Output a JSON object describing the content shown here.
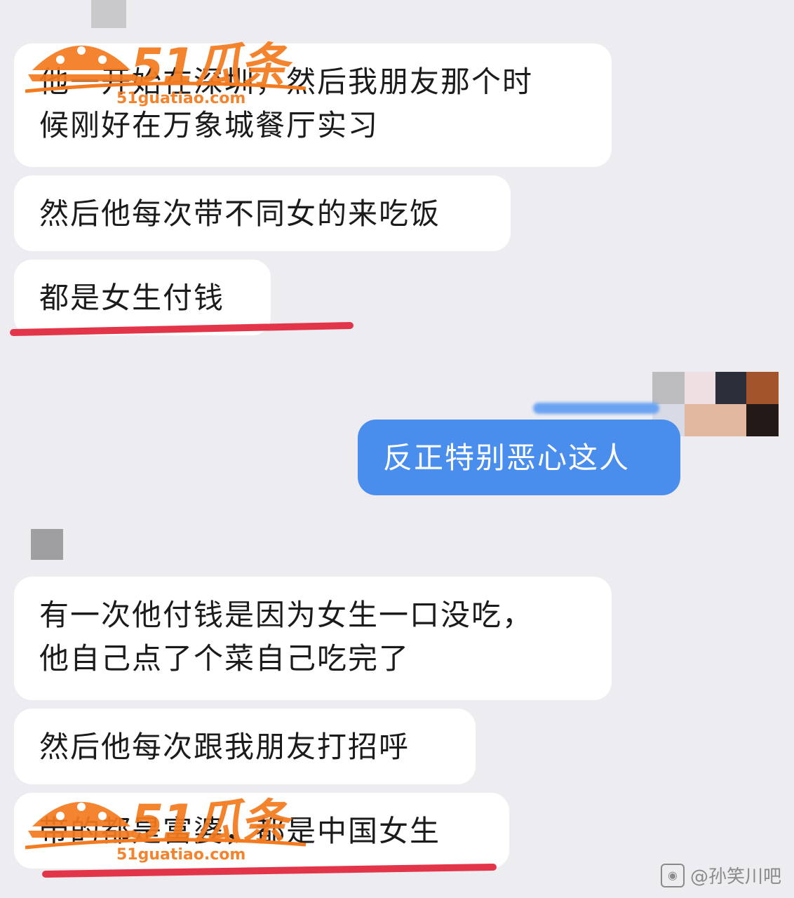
{
  "messages": [
    {
      "id": "m1",
      "direction": "received",
      "lines": [
        "他一开始在深圳，然后我朋友那个时",
        "候刚好在万象城餐厅实习"
      ]
    },
    {
      "id": "m2",
      "direction": "received",
      "lines": [
        "然后他每次带不同女的来吃饭"
      ]
    },
    {
      "id": "m3",
      "direction": "received",
      "lines": [
        "都是女生付钱"
      ],
      "underlined": true
    },
    {
      "id": "m4",
      "direction": "sent",
      "lines": [
        "反正特别恶心这人"
      ]
    },
    {
      "id": "m5",
      "direction": "received",
      "lines": [
        "有一次他付钱是因为女生一口没吃，",
        "他自己点了个菜自己吃完了"
      ]
    },
    {
      "id": "m6",
      "direction": "received",
      "lines": [
        "然后他每次跟我朋友打招呼"
      ]
    },
    {
      "id": "m7",
      "direction": "received",
      "lines": [
        "带的都是富婆，都是中国女生"
      ],
      "underlined": true
    }
  ],
  "watermark": {
    "brand": "51瓜条",
    "url": "51guatiao.com"
  },
  "credit": {
    "text": "@孙笑川吧",
    "icon": "weibo-icon"
  },
  "colors": {
    "background": "#ededf1",
    "bubble": "#ffffff",
    "sent_bubble": "#4a8eed",
    "underline": "#e2354a",
    "watermark": "#f47a1f"
  }
}
